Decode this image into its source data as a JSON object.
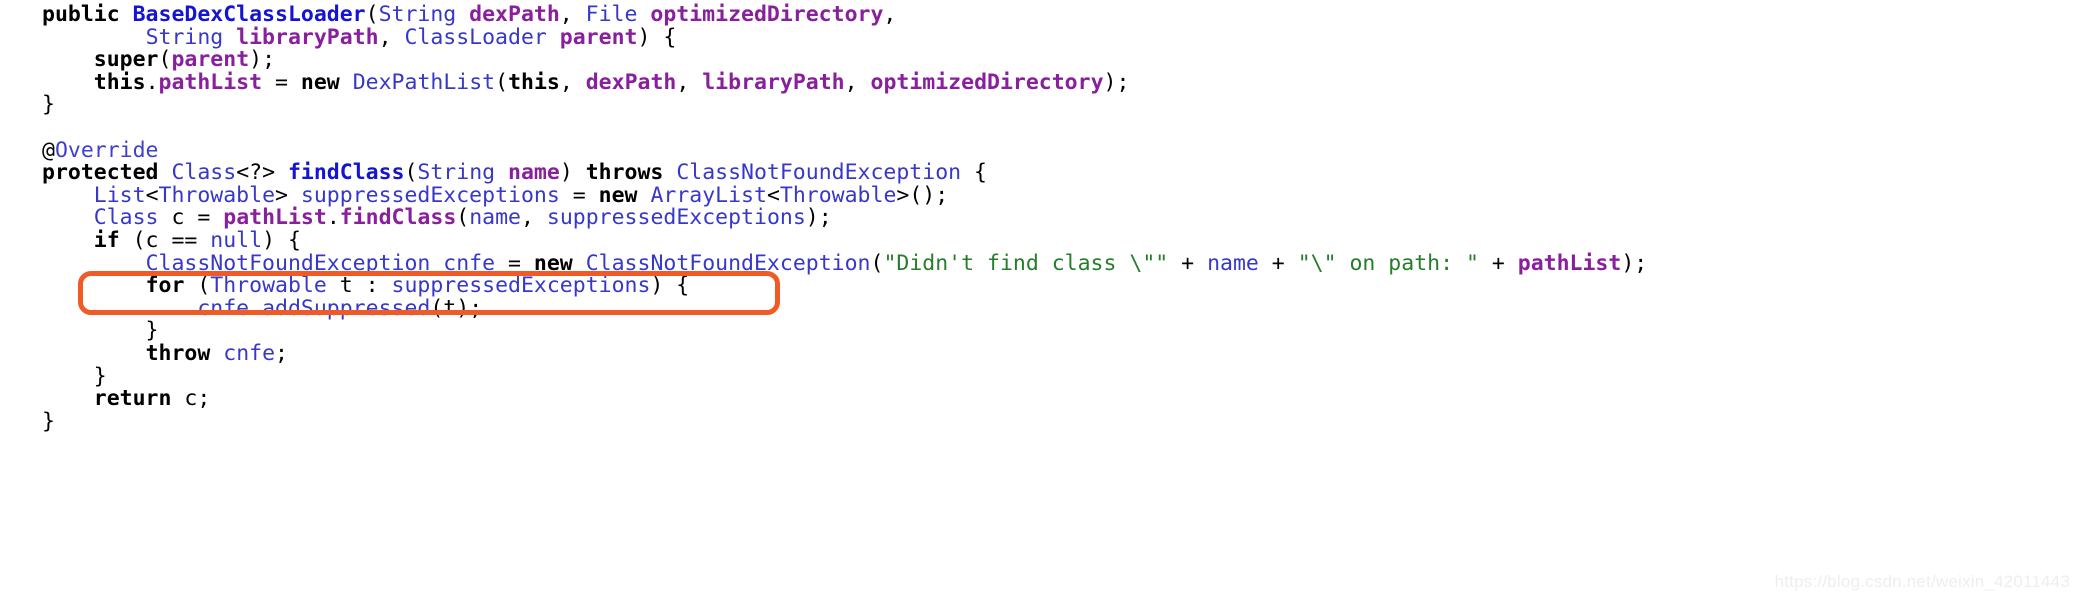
{
  "document": {
    "language": "Java",
    "title": "BaseDexClassLoader.findClass source excerpt",
    "watermark": "https://blog.csdn.net/weixin_42011443"
  },
  "colors": {
    "background": "#ffffff",
    "plain": "#000000",
    "keyword": "#000000",
    "type": "#3737c8",
    "method": "#1414d2",
    "field": "#8a1f9e",
    "annotation": "#3f3fd0",
    "string": "#267d2a",
    "highlight_border": "#ef5a27",
    "watermark": "#eeeeee"
  },
  "highlight": {
    "shape": "rounded-rectangle",
    "border_color": "#ef5a27",
    "border_width_px": 5,
    "corner_radius_px": 13,
    "target_line_index": 10,
    "target_line_text": "        Class c = pathList.findClass(name, suppressedExceptions);"
  },
  "code": {
    "plain_text": "public BaseDexClassLoader(String dexPath, File optimizedDirectory,\n        String libraryPath, ClassLoader parent) {\n    super(parent);\n    this.pathList = new DexPathList(this, dexPath, libraryPath, optimizedDirectory);\n}\n\n@Override\nprotected Class<?> findClass(String name) throws ClassNotFoundException {\n    List<Throwable> suppressedExceptions = new ArrayList<Throwable>();\n    Class c = pathList.findClass(name, suppressedExceptions);\n    if (c == null) {\n        ClassNotFoundException cnfe = new ClassNotFoundException(\"Didn't find class \\\"\" + name + \"\\\" on path: \" + pathList);\n        for (Throwable t : suppressedExceptions) {\n            cnfe.addSuppressed(t);\n        }\n        throw cnfe;\n    }\n    return c;\n}",
    "lines": [
      {
        "index": 0,
        "tokens": [
          {
            "text": "public ",
            "kind": "keyword"
          },
          {
            "text": "BaseDexClassLoader",
            "kind": "typeb"
          },
          {
            "text": "(",
            "kind": "punct"
          },
          {
            "text": "String ",
            "kind": "type"
          },
          {
            "text": "dexPath",
            "kind": "field"
          },
          {
            "text": ", ",
            "kind": "punct"
          },
          {
            "text": "File ",
            "kind": "type"
          },
          {
            "text": "optimizedDirectory",
            "kind": "field"
          },
          {
            "text": ",",
            "kind": "punct"
          }
        ]
      },
      {
        "index": 1,
        "tokens": [
          {
            "text": "        ",
            "kind": "plain"
          },
          {
            "text": "String ",
            "kind": "type"
          },
          {
            "text": "libraryPath",
            "kind": "field"
          },
          {
            "text": ", ",
            "kind": "punct"
          },
          {
            "text": "ClassLoader ",
            "kind": "type"
          },
          {
            "text": "parent",
            "kind": "field"
          },
          {
            "text": ") {",
            "kind": "punct"
          }
        ]
      },
      {
        "index": 2,
        "tokens": [
          {
            "text": "    ",
            "kind": "plain"
          },
          {
            "text": "super",
            "kind": "keyword"
          },
          {
            "text": "(",
            "kind": "punct"
          },
          {
            "text": "parent",
            "kind": "field"
          },
          {
            "text": ");",
            "kind": "punct"
          }
        ]
      },
      {
        "index": 3,
        "tokens": [
          {
            "text": "    ",
            "kind": "plain"
          },
          {
            "text": "this",
            "kind": "keyword"
          },
          {
            "text": ".",
            "kind": "punct"
          },
          {
            "text": "pathList",
            "kind": "field"
          },
          {
            "text": " = ",
            "kind": "punct"
          },
          {
            "text": "new",
            "kind": "keyword"
          },
          {
            "text": " ",
            "kind": "punct"
          },
          {
            "text": "DexPathList",
            "kind": "type"
          },
          {
            "text": "(",
            "kind": "punct"
          },
          {
            "text": "this",
            "kind": "keyword"
          },
          {
            "text": ", ",
            "kind": "punct"
          },
          {
            "text": "dexPath",
            "kind": "field"
          },
          {
            "text": ", ",
            "kind": "punct"
          },
          {
            "text": "libraryPath",
            "kind": "field"
          },
          {
            "text": ", ",
            "kind": "punct"
          },
          {
            "text": "optimizedDirectory",
            "kind": "field"
          },
          {
            "text": ");",
            "kind": "punct"
          }
        ]
      },
      {
        "index": 4,
        "tokens": [
          {
            "text": "}",
            "kind": "punct"
          }
        ]
      },
      {
        "index": 5,
        "tokens": [
          {
            "text": "",
            "kind": "plain"
          }
        ]
      },
      {
        "index": 6,
        "tokens": [
          {
            "text": "@",
            "kind": "punct"
          },
          {
            "text": "Override",
            "kind": "anno"
          }
        ]
      },
      {
        "index": 7,
        "tokens": [
          {
            "text": "protected ",
            "kind": "keyword"
          },
          {
            "text": "Class",
            "kind": "type"
          },
          {
            "text": "<?> ",
            "kind": "punct"
          },
          {
            "text": "findClass",
            "kind": "typeb"
          },
          {
            "text": "(",
            "kind": "punct"
          },
          {
            "text": "String ",
            "kind": "type"
          },
          {
            "text": "name",
            "kind": "field"
          },
          {
            "text": ") ",
            "kind": "punct"
          },
          {
            "text": "throws ",
            "kind": "keyword"
          },
          {
            "text": "ClassNotFoundException",
            "kind": "type"
          },
          {
            "text": " {",
            "kind": "punct"
          }
        ]
      },
      {
        "index": 8,
        "tokens": [
          {
            "text": "    ",
            "kind": "plain"
          },
          {
            "text": "List",
            "kind": "type"
          },
          {
            "text": "<",
            "kind": "punct"
          },
          {
            "text": "Throwable",
            "kind": "type"
          },
          {
            "text": "> ",
            "kind": "punct"
          },
          {
            "text": "suppressedExceptions",
            "kind": "ident"
          },
          {
            "text": " = ",
            "kind": "punct"
          },
          {
            "text": "new",
            "kind": "keyword"
          },
          {
            "text": " ",
            "kind": "punct"
          },
          {
            "text": "ArrayList",
            "kind": "type"
          },
          {
            "text": "<",
            "kind": "punct"
          },
          {
            "text": "Throwable",
            "kind": "type"
          },
          {
            "text": ">();",
            "kind": "punct"
          }
        ]
      },
      {
        "index": 9,
        "tokens": [
          {
            "text": "    ",
            "kind": "plain"
          },
          {
            "text": "Class",
            "kind": "type"
          },
          {
            "text": " c = ",
            "kind": "punct"
          },
          {
            "text": "pathList",
            "kind": "field"
          },
          {
            "text": ".",
            "kind": "punct"
          },
          {
            "text": "findClass",
            "kind": "field"
          },
          {
            "text": "(",
            "kind": "punct"
          },
          {
            "text": "name",
            "kind": "ident"
          },
          {
            "text": ", ",
            "kind": "punct"
          },
          {
            "text": "suppressedExceptions",
            "kind": "ident"
          },
          {
            "text": ");",
            "kind": "punct"
          }
        ]
      },
      {
        "index": 10,
        "tokens": [
          {
            "text": "    ",
            "kind": "plain"
          },
          {
            "text": "if",
            "kind": "keyword"
          },
          {
            "text": " (c == ",
            "kind": "punct"
          },
          {
            "text": "null",
            "kind": "type"
          },
          {
            "text": ") {",
            "kind": "punct"
          }
        ]
      },
      {
        "index": 11,
        "tokens": [
          {
            "text": "        ",
            "kind": "plain"
          },
          {
            "text": "ClassNotFoundException",
            "kind": "type"
          },
          {
            "text": " ",
            "kind": "punct"
          },
          {
            "text": "cnfe",
            "kind": "ident"
          },
          {
            "text": " = ",
            "kind": "punct"
          },
          {
            "text": "new",
            "kind": "keyword"
          },
          {
            "text": " ",
            "kind": "punct"
          },
          {
            "text": "ClassNotFoundException",
            "kind": "type"
          },
          {
            "text": "(",
            "kind": "punct"
          },
          {
            "text": "\"Didn't find class \\\"\"",
            "kind": "string"
          },
          {
            "text": " + ",
            "kind": "punct"
          },
          {
            "text": "name",
            "kind": "ident"
          },
          {
            "text": " + ",
            "kind": "punct"
          },
          {
            "text": "\"\\\" on path: \"",
            "kind": "string"
          },
          {
            "text": " + ",
            "kind": "punct"
          },
          {
            "text": "pathList",
            "kind": "field"
          },
          {
            "text": ");",
            "kind": "punct"
          }
        ]
      },
      {
        "index": 12,
        "tokens": [
          {
            "text": "        ",
            "kind": "plain"
          },
          {
            "text": "for",
            "kind": "keyword"
          },
          {
            "text": " (",
            "kind": "punct"
          },
          {
            "text": "Throwable",
            "kind": "type"
          },
          {
            "text": " t : ",
            "kind": "punct"
          },
          {
            "text": "suppressedExceptions",
            "kind": "ident"
          },
          {
            "text": ") {",
            "kind": "punct"
          }
        ]
      },
      {
        "index": 13,
        "tokens": [
          {
            "text": "            ",
            "kind": "plain"
          },
          {
            "text": "cnfe",
            "kind": "ident"
          },
          {
            "text": ".",
            "kind": "punct"
          },
          {
            "text": "addSuppressed",
            "kind": "ident"
          },
          {
            "text": "(t);",
            "kind": "punct"
          }
        ]
      },
      {
        "index": 14,
        "tokens": [
          {
            "text": "        }",
            "kind": "punct"
          }
        ]
      },
      {
        "index": 15,
        "tokens": [
          {
            "text": "        ",
            "kind": "plain"
          },
          {
            "text": "throw",
            "kind": "keyword"
          },
          {
            "text": " ",
            "kind": "punct"
          },
          {
            "text": "cnfe",
            "kind": "ident"
          },
          {
            "text": ";",
            "kind": "punct"
          }
        ]
      },
      {
        "index": 16,
        "tokens": [
          {
            "text": "    }",
            "kind": "punct"
          }
        ]
      },
      {
        "index": 17,
        "tokens": [
          {
            "text": "    ",
            "kind": "plain"
          },
          {
            "text": "return",
            "kind": "keyword"
          },
          {
            "text": " c;",
            "kind": "punct"
          }
        ]
      },
      {
        "index": 18,
        "tokens": [
          {
            "text": "}",
            "kind": "punct"
          }
        ]
      }
    ]
  }
}
